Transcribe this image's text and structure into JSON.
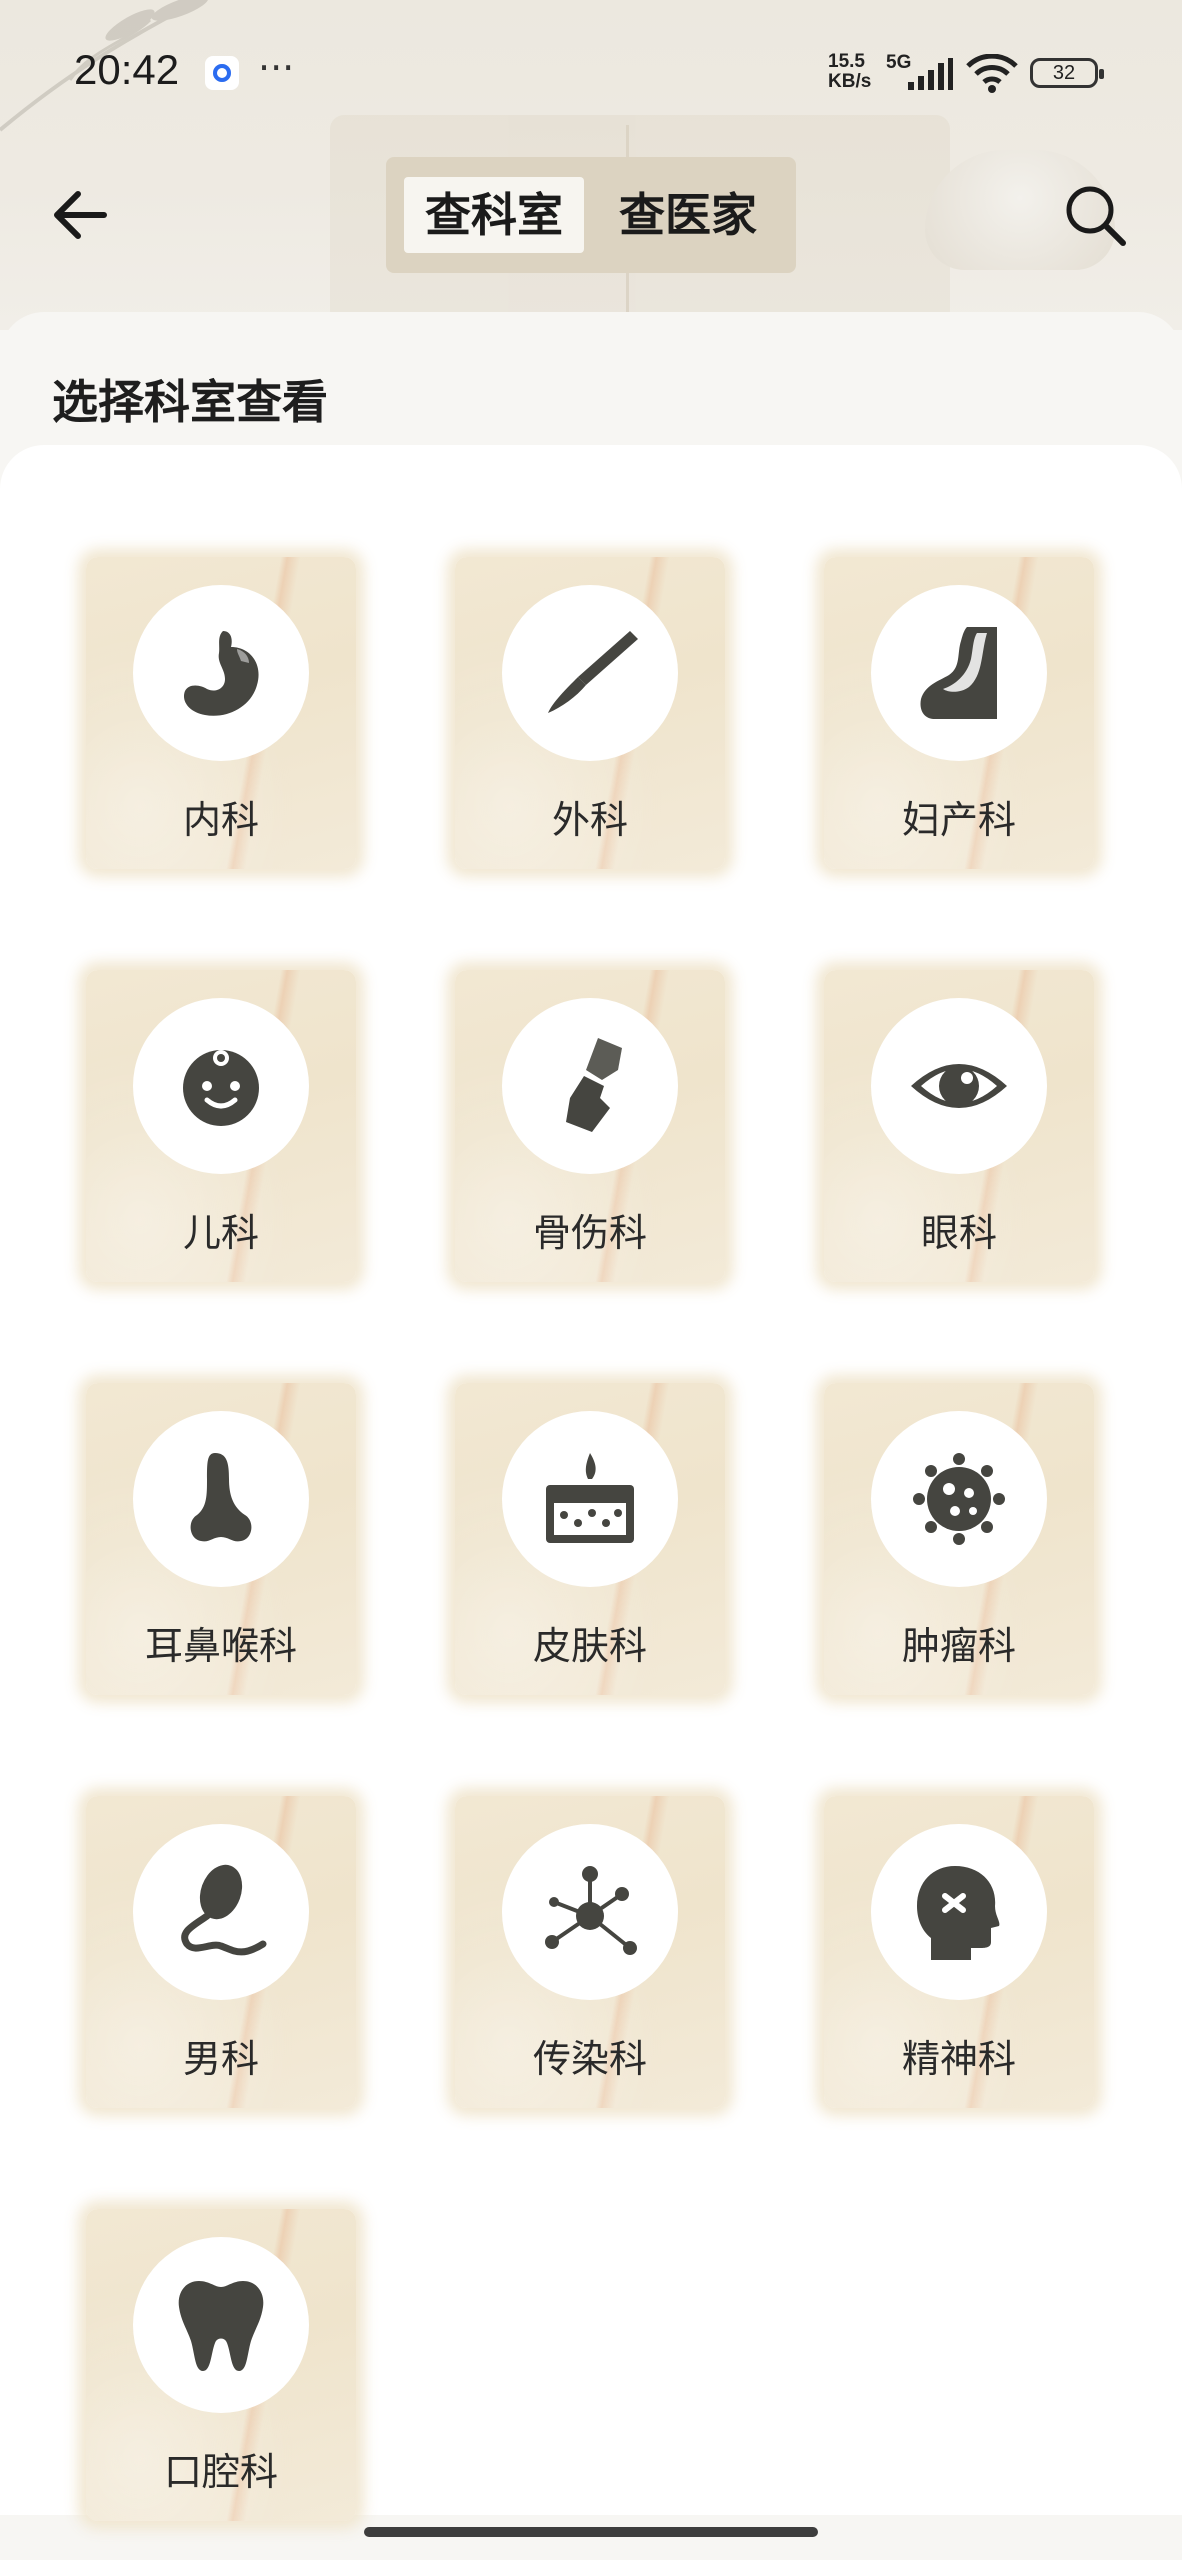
{
  "status_bar": {
    "time": "20:42",
    "more": "···",
    "net_speed": "15.5\nKB/s",
    "network": "5G",
    "battery": "32"
  },
  "header": {
    "back_icon": "arrow-left-icon",
    "tabs": [
      {
        "label": "查科室",
        "active": true
      },
      {
        "label": "查医家",
        "active": false
      }
    ],
    "search_icon": "search-icon"
  },
  "section_title": "选择科室查看",
  "departments": [
    {
      "label": "内科",
      "icon": "stomach-icon"
    },
    {
      "label": "外科",
      "icon": "scalpel-icon"
    },
    {
      "label": "妇产科",
      "icon": "uterus-icon"
    },
    {
      "label": "儿科",
      "icon": "baby-face-icon"
    },
    {
      "label": "骨伤科",
      "icon": "bone-joint-icon"
    },
    {
      "label": "眼科",
      "icon": "eye-icon"
    },
    {
      "label": "耳鼻喉科",
      "icon": "nose-icon"
    },
    {
      "label": "皮肤科",
      "icon": "skin-layer-icon"
    },
    {
      "label": "肿瘤科",
      "icon": "tumor-cell-icon"
    },
    {
      "label": "男科",
      "icon": "sperm-icon"
    },
    {
      "label": "传染科",
      "icon": "virus-molecule-icon"
    },
    {
      "label": "精神科",
      "icon": "head-profile-icon"
    },
    {
      "label": "口腔科",
      "icon": "tooth-icon"
    }
  ],
  "colors": {
    "icon_fill": "#454540",
    "card_bg": "#efe4cc",
    "segment_bg": "#dcd3c1"
  }
}
